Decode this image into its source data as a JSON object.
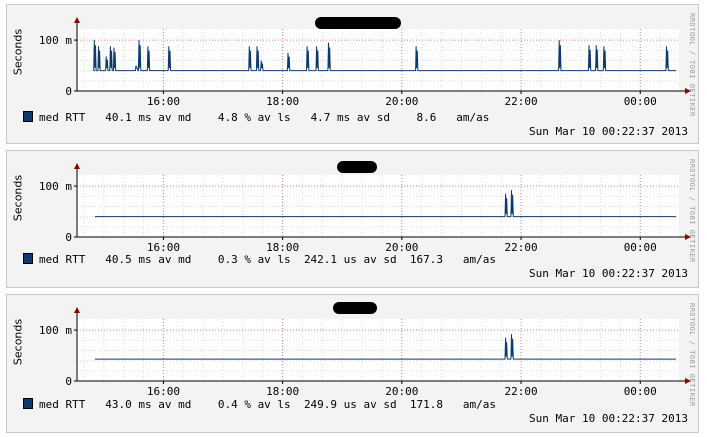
{
  "side_text": "RRDTOOL / TOBI OETIKER",
  "colors": {
    "line": "#0d3a6b",
    "grid_major": "#e08080",
    "grid_minor": "#dcdcdc",
    "axis": "#000000",
    "arrow": "#8b0000"
  },
  "panels": [
    {
      "ylabel": "Seconds",
      "legend": {
        "series_label": "med RTT",
        "avg_md": "40.1 ms av md",
        "loss": "4.8 % av ls",
        "avg_sd": "4.7 ms av sd",
        "am_as_value": "8.6",
        "am_as_label": "am/as"
      },
      "timestamp": "Sun Mar 10 00:22:37 2013"
    },
    {
      "ylabel": "Seconds",
      "legend": {
        "series_label": "med RTT",
        "avg_md": "40.5 ms av md",
        "loss": "0.3 % av ls",
        "avg_sd": "242.1 us av sd",
        "am_as_value": "167.3",
        "am_as_label": "am/as"
      },
      "timestamp": "Sun Mar 10 00:22:37 2013"
    },
    {
      "ylabel": "Seconds",
      "legend": {
        "series_label": "med RTT",
        "avg_md": "43.0 ms av md",
        "loss": "0.4 % av ls",
        "avg_sd": "249.9 us av sd",
        "am_as_value": "171.8",
        "am_as_label": "am/as"
      },
      "timestamp": "Sun Mar 10 00:22:37 2013"
    }
  ],
  "chart_data": [
    {
      "type": "line",
      "x_unit": "hours since 00:00 of Mar 9 2013",
      "xlim": [
        14.55,
        24.65
      ],
      "ylim": [
        0,
        110
      ],
      "x_ticks": [
        16,
        18,
        20,
        22,
        24
      ],
      "x_tick_labels": [
        "16:00",
        "18:00",
        "20:00",
        "22:00",
        "00:00"
      ],
      "y_ticks": [
        0,
        100
      ],
      "y_tick_labels": [
        "0",
        "100 m"
      ],
      "ylabel": "Seconds",
      "grid": true,
      "baseline": 40,
      "spikes": [
        {
          "x": 14.85,
          "y": 100
        },
        {
          "x": 14.92,
          "y": 88
        },
        {
          "x": 15.05,
          "y": 68
        },
        {
          "x": 15.12,
          "y": 88
        },
        {
          "x": 15.18,
          "y": 85
        },
        {
          "x": 15.55,
          "y": 50
        },
        {
          "x": 15.6,
          "y": 100
        },
        {
          "x": 15.75,
          "y": 88
        },
        {
          "x": 16.1,
          "y": 88
        },
        {
          "x": 17.45,
          "y": 88
        },
        {
          "x": 17.58,
          "y": 88
        },
        {
          "x": 17.65,
          "y": 60
        },
        {
          "x": 18.1,
          "y": 75
        },
        {
          "x": 18.42,
          "y": 88
        },
        {
          "x": 18.58,
          "y": 88
        },
        {
          "x": 18.78,
          "y": 95
        },
        {
          "x": 20.25,
          "y": 88
        },
        {
          "x": 22.65,
          "y": 100
        },
        {
          "x": 23.15,
          "y": 90
        },
        {
          "x": 23.27,
          "y": 90
        },
        {
          "x": 23.4,
          "y": 88
        },
        {
          "x": 24.45,
          "y": 88
        }
      ]
    },
    {
      "type": "line",
      "x_unit": "hours since 00:00 of Mar 9 2013",
      "xlim": [
        14.55,
        24.65
      ],
      "ylim": [
        0,
        110
      ],
      "x_ticks": [
        16,
        18,
        20,
        22,
        24
      ],
      "x_tick_labels": [
        "16:00",
        "18:00",
        "20:00",
        "22:00",
        "00:00"
      ],
      "y_ticks": [
        0,
        100
      ],
      "y_tick_labels": [
        "0",
        "100 m"
      ],
      "ylabel": "Seconds",
      "grid": true,
      "baseline": 40,
      "spikes": [
        {
          "x": 21.75,
          "y": 85
        },
        {
          "x": 21.85,
          "y": 92
        }
      ]
    },
    {
      "type": "line",
      "x_unit": "hours since 00:00 of Mar 9 2013",
      "xlim": [
        14.55,
        24.65
      ],
      "ylim": [
        0,
        110
      ],
      "x_ticks": [
        16,
        18,
        20,
        22,
        24
      ],
      "x_tick_labels": [
        "16:00",
        "18:00",
        "20:00",
        "22:00",
        "00:00"
      ],
      "y_ticks": [
        0,
        100
      ],
      "y_tick_labels": [
        "0",
        "100 m"
      ],
      "ylabel": "Seconds",
      "grid": true,
      "baseline": 43,
      "spikes": [
        {
          "x": 21.75,
          "y": 85
        },
        {
          "x": 21.85,
          "y": 92
        }
      ]
    }
  ]
}
